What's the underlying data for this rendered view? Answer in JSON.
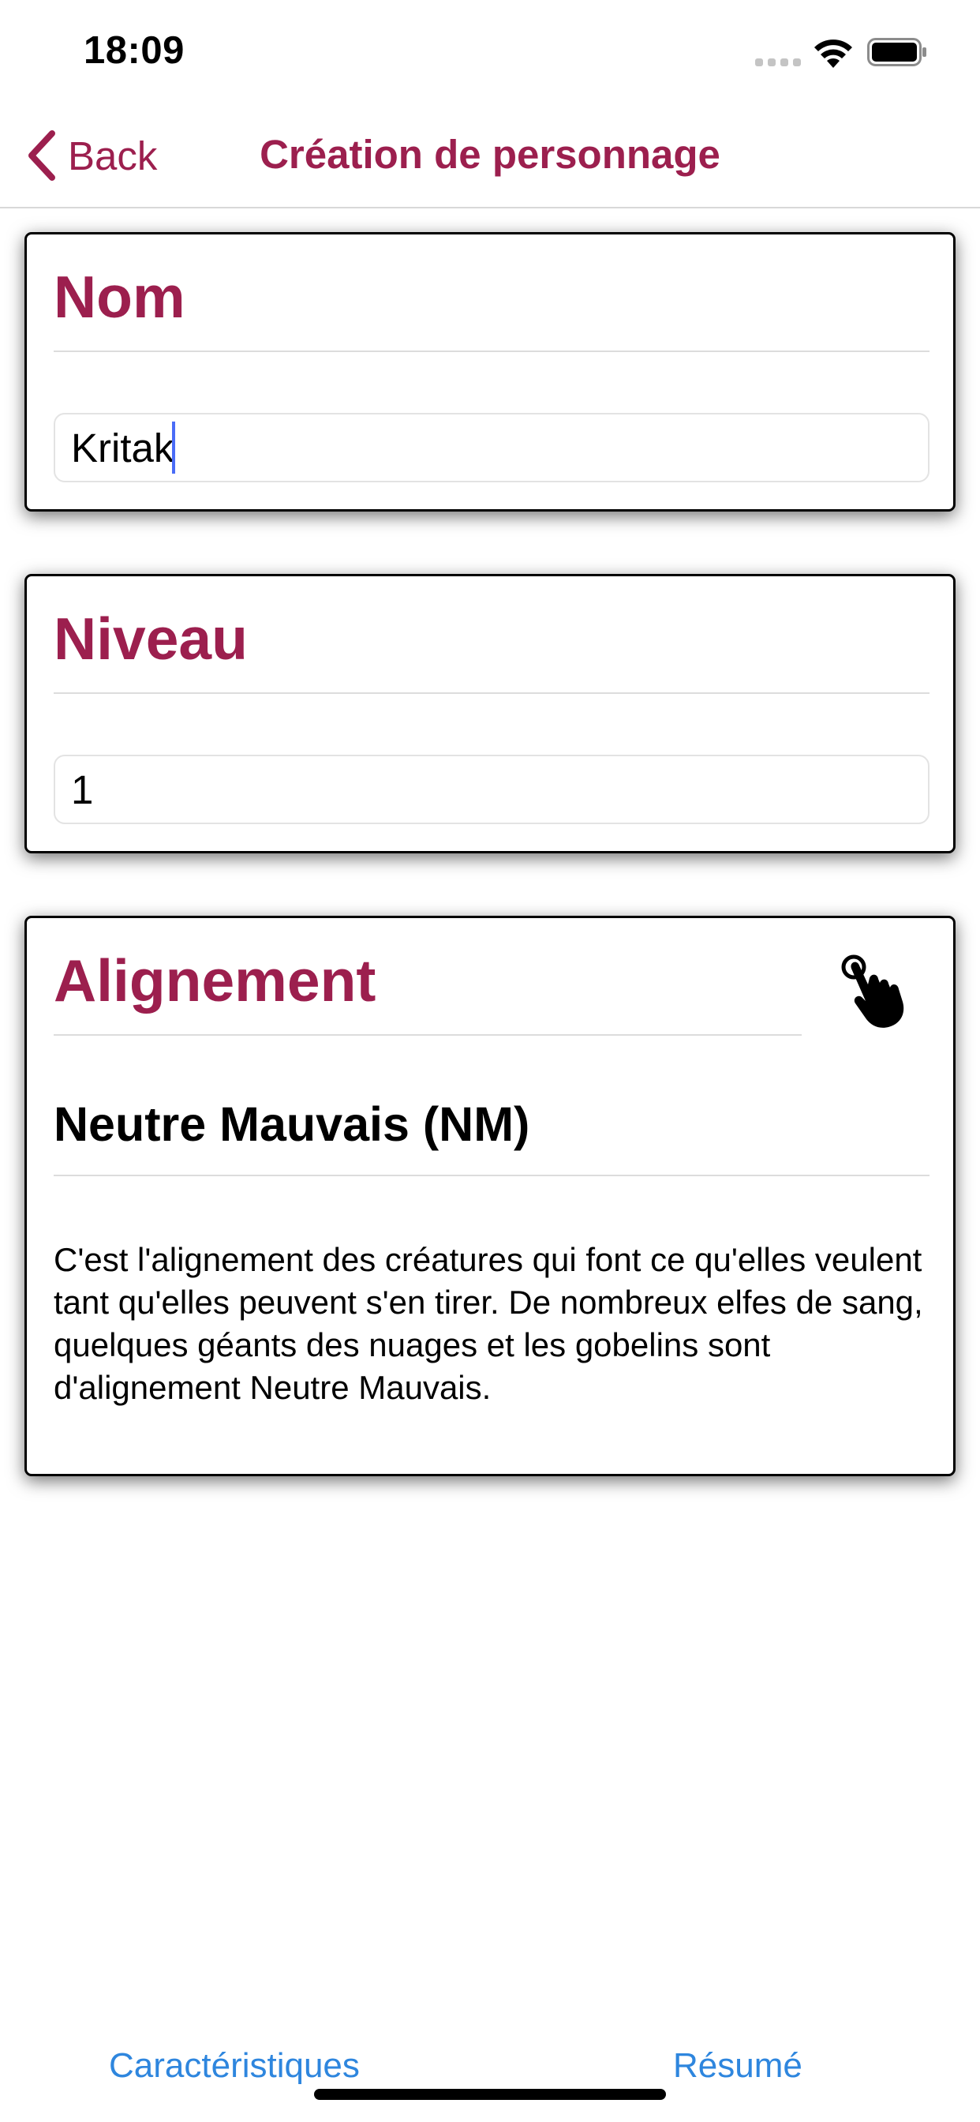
{
  "status_bar": {
    "time": "18:09",
    "icons": [
      "cellular-signal-icon",
      "wifi-icon",
      "battery-icon"
    ]
  },
  "nav": {
    "back_label": "Back",
    "title": "Création de personnage",
    "accent_color": "#9c1f4e"
  },
  "name_card": {
    "header": "Nom",
    "input_value": "Kritak"
  },
  "level_card": {
    "header": "Niveau",
    "input_value": "1"
  },
  "alignment_card": {
    "header": "Alignement",
    "icon": "tap-hand-icon",
    "selected": "Neutre Mauvais (NM)",
    "description": "C'est l'alignement des créatures qui font ce qu'elles veulent tant qu'elles peuvent s'en tirer. De nombreux elfes de sang, quelques géants des nuages et les gobelins sont d'alignement Neutre Mauvais."
  },
  "bottom": {
    "left_link": "Caractéristiques",
    "right_link": "Résumé",
    "link_color": "#2e86de"
  }
}
